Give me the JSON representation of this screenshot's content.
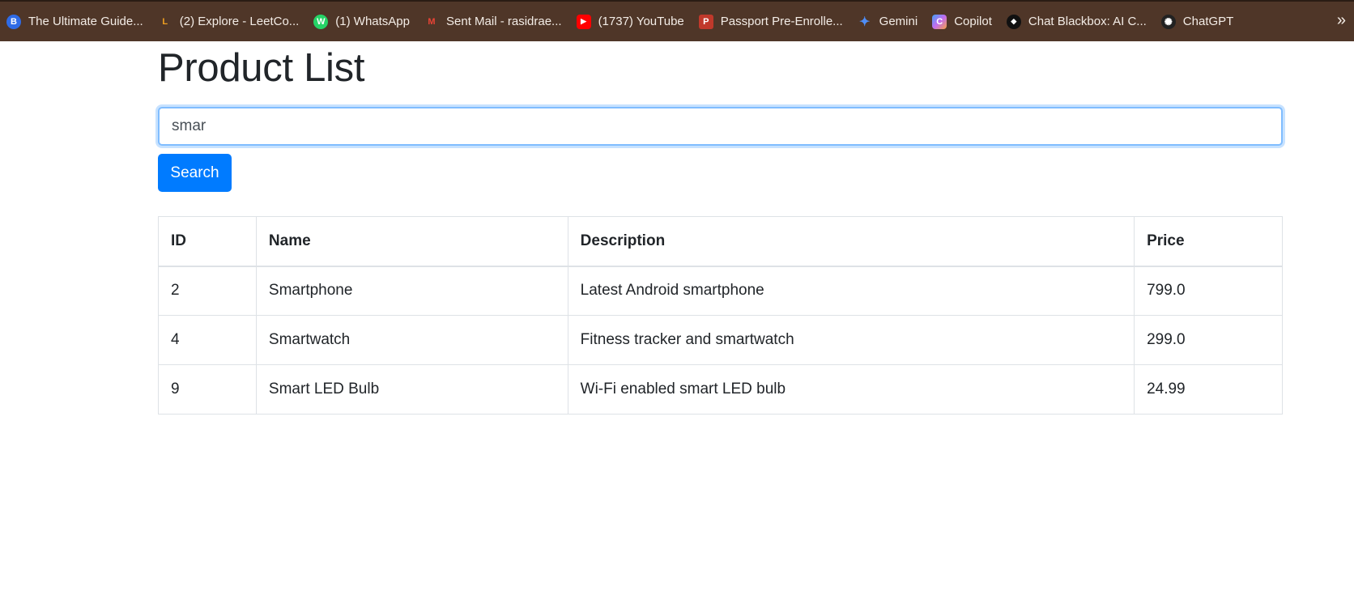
{
  "bookmarks": [
    {
      "label": "The Ultimate Guide...",
      "icon": "bookmark-icon-guide",
      "color": "#2f6be6",
      "glyph": "B"
    },
    {
      "label": "(2) Explore - LeetCo...",
      "icon": "leetcode-icon",
      "color": "#f0a020",
      "glyph": "L"
    },
    {
      "label": "(1) WhatsApp",
      "icon": "whatsapp-icon",
      "color": "#25d366",
      "glyph": "W"
    },
    {
      "label": "Sent Mail - rasidrae...",
      "icon": "gmail-icon",
      "color": "#ea4335",
      "glyph": "M"
    },
    {
      "label": "(1737) YouTube",
      "icon": "youtube-icon",
      "color": "#ff0000",
      "glyph": "▶"
    },
    {
      "label": "Passport Pre-Enrolle...",
      "icon": "passport-icon",
      "color": "#c0392b",
      "glyph": "P"
    },
    {
      "label": "Gemini",
      "icon": "gemini-icon",
      "color": "#4f8ef7",
      "glyph": "✦"
    },
    {
      "label": "Copilot",
      "icon": "copilot-icon",
      "color": "#9b59d0",
      "glyph": "C"
    },
    {
      "label": "Chat Blackbox: AI C...",
      "icon": "blackbox-icon",
      "color": "#111111",
      "glyph": "◆"
    },
    {
      "label": "ChatGPT",
      "icon": "chatgpt-icon",
      "color": "#222222",
      "glyph": "✺"
    }
  ],
  "bookmarks_overflow": "»",
  "page": {
    "title": "Product List",
    "search_value": "smar",
    "search_button": "Search"
  },
  "table": {
    "headers": {
      "id": "ID",
      "name": "Name",
      "description": "Description",
      "price": "Price"
    },
    "rows": [
      {
        "id": "2",
        "name": "Smartphone",
        "description": "Latest Android smartphone",
        "price": "799.0"
      },
      {
        "id": "4",
        "name": "Smartwatch",
        "description": "Fitness tracker and smartwatch",
        "price": "299.0"
      },
      {
        "id": "9",
        "name": "Smart LED Bulb",
        "description": "Wi-Fi enabled smart LED bulb",
        "price": "24.99"
      }
    ]
  },
  "colors": {
    "bookmark_bar_bg": "#4f3628",
    "primary_button": "#007bff",
    "input_focus_border": "#80bdff",
    "table_border": "#dee2e6"
  }
}
